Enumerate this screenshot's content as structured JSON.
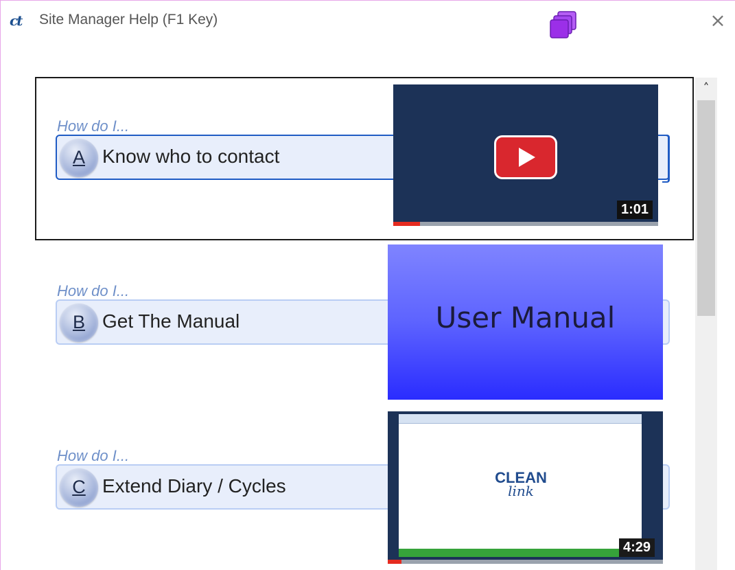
{
  "window": {
    "title": "Site Manager Help (F1 Key)",
    "logo_text": "ct",
    "close_glyph": "×",
    "icons": {
      "app": "ct-logo-icon",
      "stack": "stacked-squares-icon",
      "close": "close-icon"
    },
    "accent_color": "#9b2fe8"
  },
  "items": [
    {
      "prompt": "How do I...",
      "letter": "A",
      "label": "Know who to contact",
      "media": {
        "type": "video",
        "duration": "1:01",
        "progress_percent": 10,
        "icon": "youtube-play-icon"
      }
    },
    {
      "prompt": "How do I...",
      "letter": "B",
      "label": "Get The Manual",
      "media": {
        "type": "document",
        "text": "User Manual"
      }
    },
    {
      "prompt": "How do I...",
      "letter": "C",
      "label": "Extend Diary / Cycles",
      "media": {
        "type": "video",
        "duration": "4:29",
        "progress_percent": 5,
        "logo_top": "CLEAN",
        "logo_bottom": "link"
      }
    }
  ],
  "scrollbar": {
    "up_glyph": "˄",
    "position_percent": 0
  }
}
